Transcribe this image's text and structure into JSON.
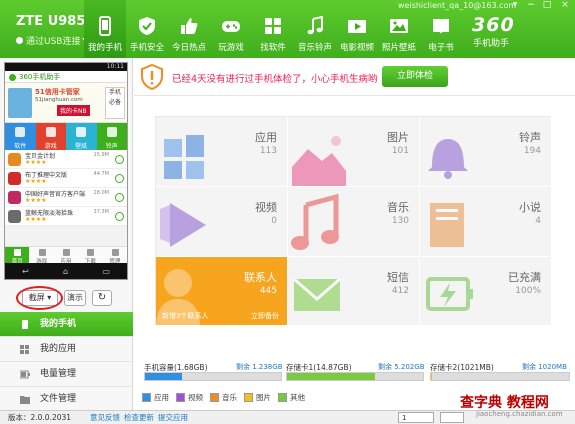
{
  "header": {
    "device_name": "ZTE U985",
    "connection": "通过USB连接",
    "email": "weishiclient_qa_10@163.com",
    "brand_num": "360",
    "brand_name": "手机助手",
    "window_controls": [
      "▾",
      "−",
      "□",
      "×"
    ]
  },
  "nav": [
    {
      "label": "我的手机",
      "icon": "phone-icon"
    },
    {
      "label": "手机安全",
      "icon": "shield-icon"
    },
    {
      "label": "今日热点",
      "icon": "thumbs-up-icon"
    },
    {
      "label": "玩游戏",
      "icon": "gamepad-icon"
    },
    {
      "label": "找软件",
      "icon": "app-grid-icon"
    },
    {
      "label": "音乐铃声",
      "icon": "music-note-icon"
    },
    {
      "label": "电影视频",
      "icon": "film-icon"
    },
    {
      "label": "照片壁纸",
      "icon": "photo-icon"
    },
    {
      "label": "电子书",
      "icon": "book-icon"
    }
  ],
  "phone": {
    "status": "10:11",
    "app_title": "360手机助手",
    "banner_title": "51信用卡管家",
    "banner_sub": "51jianghuan.com",
    "banner_tag": "我的卡NB",
    "banner_side": [
      "手机",
      "必备"
    ],
    "categories": [
      {
        "label": "软件",
        "color": "#2f8fe0"
      },
      {
        "label": "游戏",
        "color": "#e0422e"
      },
      {
        "label": "壁纸",
        "color": "#2bb3d4"
      },
      {
        "label": "铃声",
        "color": "#3fae1c"
      }
    ],
    "list": [
      {
        "name": "宝贝金计划",
        "size": "15.9M",
        "color": "#e58a1c"
      },
      {
        "name": "布丁推理中文版",
        "size": "44.7M",
        "color": "#d02a2a"
      },
      {
        "name": "中国好声音官方客户端",
        "size": "28.0M",
        "color": "#c02a60"
      },
      {
        "name": "蓝鲸无限淡海拾珠",
        "size": "37.3M",
        "color": "#6b6b6b"
      }
    ],
    "tabs": [
      "首页",
      "游戏",
      "应用",
      "下载",
      "管理"
    ],
    "nav_keys": [
      "↩",
      "⌂",
      "▭"
    ]
  },
  "phone_buttons": {
    "screenshot": "截屏",
    "demo": "演示",
    "refresh": "↻"
  },
  "left_menu": [
    "我的手机",
    "我的应用",
    "电量管理",
    "文件管理"
  ],
  "warning": {
    "text": "已经4天没有进行过手机体检了，小心手机生病哟",
    "button": "立即体检"
  },
  "tiles": [
    {
      "title": "应用",
      "count": "113",
      "theme": "#3a7fd8"
    },
    {
      "title": "图片",
      "count": "101",
      "theme": "#e84c8c"
    },
    {
      "title": "铃声",
      "count": "194",
      "theme": "#8a5fd0"
    },
    {
      "title": "视频",
      "count": "0",
      "theme": "#8a5fd0"
    },
    {
      "title": "音乐",
      "count": "130",
      "theme": "#e84c4c"
    },
    {
      "title": "小说",
      "count": "4",
      "theme": "#e8944c"
    },
    {
      "title": "联系人",
      "count": "445",
      "theme": "#f7a51f",
      "extra": "新增3个联系人",
      "link": "立即备份"
    },
    {
      "title": "短信",
      "count": "412",
      "theme": "#3aa51b"
    },
    {
      "title": "已充满",
      "count": "100%",
      "theme": "#6cc04a"
    }
  ],
  "storage": [
    {
      "label": "手机容量(1.68GB)",
      "free_label": "剩余 1.238GB",
      "fill_ratio": 0.27,
      "color": "#2f8fe0"
    },
    {
      "label": "存储卡1(14.87GB)",
      "free_label": "剩余 5.202GB",
      "fill_ratio": 0.65,
      "color": "#7ac942"
    },
    {
      "label": "存储卡2(1021MB)",
      "free_label": "剩余 1020MB",
      "fill_ratio": 0.01,
      "color": "#f0c020"
    }
  ],
  "legend": [
    {
      "label": "应用",
      "color": "#2f8fe0"
    },
    {
      "label": "视频",
      "color": "#a04fd6"
    },
    {
      "label": "音乐",
      "color": "#f08a24"
    },
    {
      "label": "图片",
      "color": "#f0c020"
    },
    {
      "label": "其他",
      "color": "#7ac942"
    }
  ],
  "footer": {
    "version": "版本：2.0.0.2031",
    "links": [
      "意见反馈",
      "检查更新",
      "提交应用"
    ],
    "page": "1"
  },
  "watermark": {
    "text": "查字典 教程网",
    "url": "jiaocheng.chazidian.com"
  }
}
